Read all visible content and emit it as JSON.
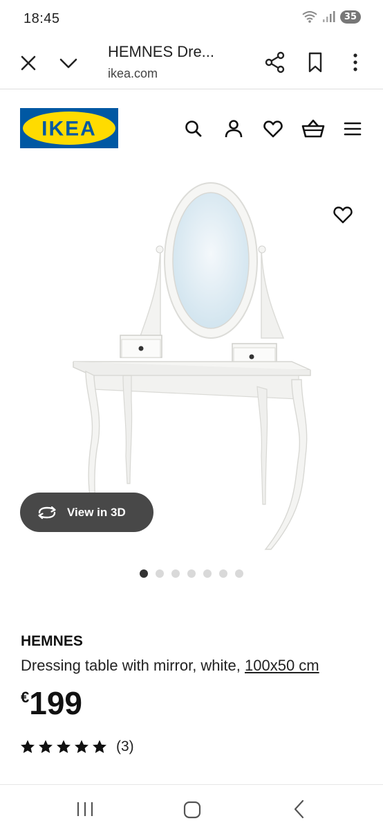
{
  "status_bar": {
    "time": "18:45",
    "battery": "35"
  },
  "browser": {
    "page_title": "HEMNES Dre...",
    "domain": "ikea.com"
  },
  "site": {
    "logo_text": "IKEA",
    "colors": {
      "brand_blue": "#0058A3",
      "brand_yellow": "#FFDB00"
    },
    "header_icons": [
      "search-icon",
      "profile-icon",
      "heart-icon",
      "basket-icon",
      "hamburger-menu-icon"
    ]
  },
  "gallery": {
    "view_3d_label": "View in 3D",
    "image_count": 7,
    "active_index": 0
  },
  "product": {
    "name": "HEMNES",
    "description": "Dressing table with mirror, white, ",
    "size": "100x50 cm",
    "currency": "€",
    "price": "199",
    "rating": 5,
    "rating_max": 5,
    "review_count": "(3)"
  }
}
